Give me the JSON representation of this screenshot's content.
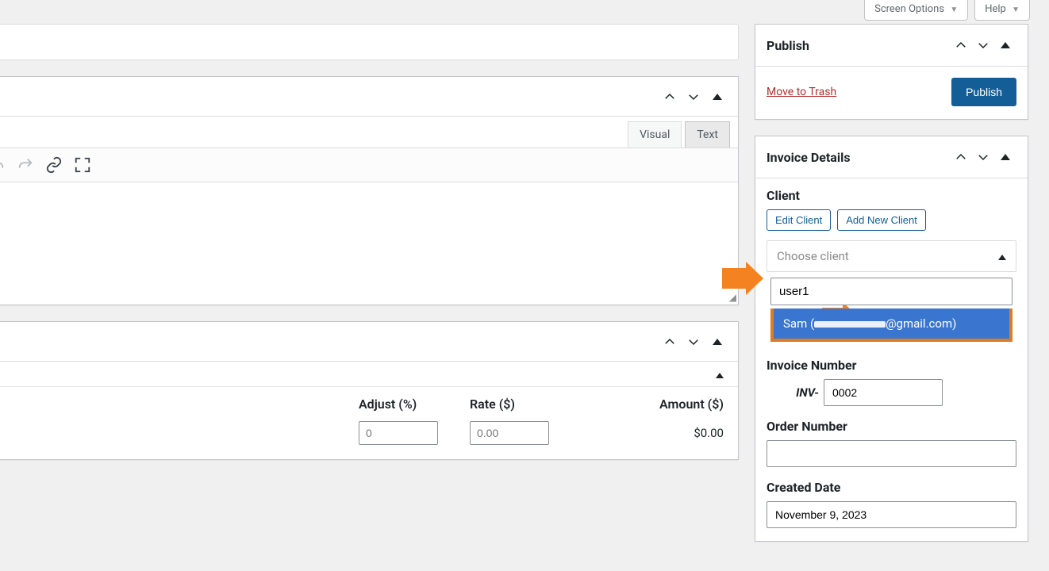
{
  "top": {
    "screen_options": "Screen Options",
    "help": "Help"
  },
  "title_placeholder": "",
  "editor": {
    "tab_visual": "Visual",
    "tab_text": "Text"
  },
  "lineitems": {
    "col_adjust": "Adjust (%)",
    "col_rate": "Rate ($)",
    "col_amount": "Amount ($)",
    "adjust_placeholder": "0",
    "rate_placeholder": "0.00",
    "amount_value": "$0.00"
  },
  "publish": {
    "panel_title": "Publish",
    "trash": "Move to Trash",
    "button": "Publish"
  },
  "invoice_details": {
    "panel_title": "Invoice Details",
    "client_label": "Client",
    "edit_client": "Edit Client",
    "add_new_client": "Add New Client",
    "choose_client": "Choose client",
    "search_value": "user1",
    "option_text_prefix": "Sam (",
    "option_text_suffix": "@gmail.com)",
    "invoice_number_label": "Invoice Number",
    "invoice_prefix": "INV-",
    "invoice_value": "0002",
    "order_number_label": "Order Number",
    "order_value": "",
    "created_date_label": "Created Date",
    "created_date_value": "November 9, 2023"
  }
}
